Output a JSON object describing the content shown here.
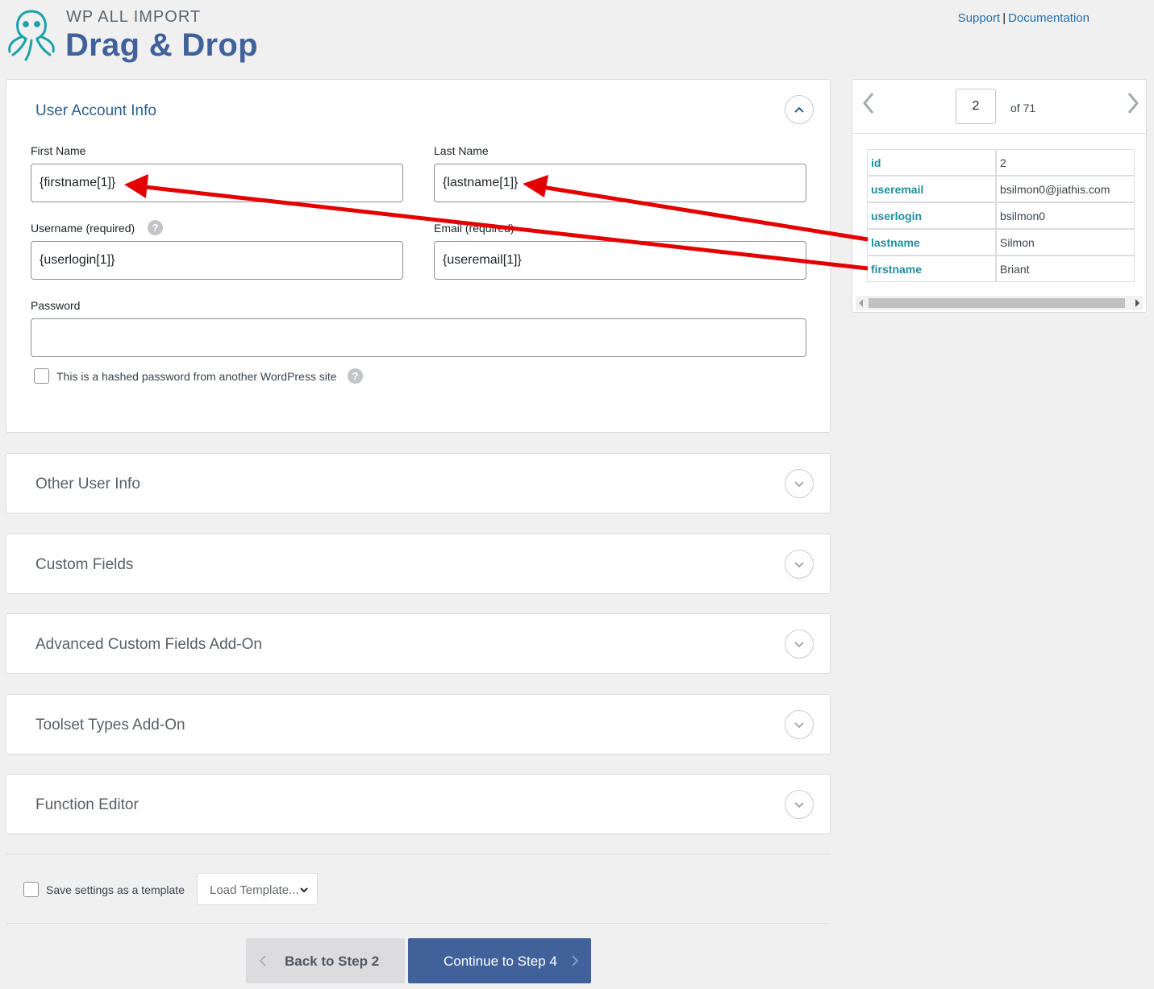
{
  "header": {
    "brand_small": "WP ALL IMPORT",
    "brand_big": "Drag & Drop",
    "links": {
      "support": "Support",
      "separator": "|",
      "documentation": "Documentation"
    }
  },
  "user_account": {
    "title": "User Account Info",
    "first_name_label": "First Name",
    "first_name_value": "{firstname[1]}",
    "last_name_label": "Last Name",
    "last_name_value": "{lastname[1]}",
    "username_label": "Username (required)",
    "username_value": "{userlogin[1]}",
    "email_label": "Email (required)",
    "email_value": "{useremail[1]}",
    "password_label": "Password",
    "password_value": "",
    "hashed_label": "This is a hashed password from another WordPress site",
    "help_glyph": "?"
  },
  "sections": [
    {
      "title": "Other User Info"
    },
    {
      "title": "Custom Fields"
    },
    {
      "title": "Advanced Custom Fields Add-On"
    },
    {
      "title": "Toolset Types Add-On"
    },
    {
      "title": "Function Editor"
    }
  ],
  "preview": {
    "current_record": "2",
    "of_total": "of 71",
    "rows": [
      {
        "key": "id",
        "value": "2"
      },
      {
        "key": "useremail",
        "value": "bsilmon0@jiathis.com"
      },
      {
        "key": "userlogin",
        "value": "bsilmon0"
      },
      {
        "key": "lastname",
        "value": "Silmon"
      },
      {
        "key": "firstname",
        "value": "Briant"
      }
    ]
  },
  "footer": {
    "save_template_label": "Save settings as a template",
    "load_template": "Load Template...",
    "back_label": "Back to Step 2",
    "continue_label": "Continue to Step 4"
  },
  "colors": {
    "accent": "#40619a",
    "annotation_arrow": "#e50000",
    "key_text": "#1d8f9e",
    "link": "#2271b1"
  }
}
